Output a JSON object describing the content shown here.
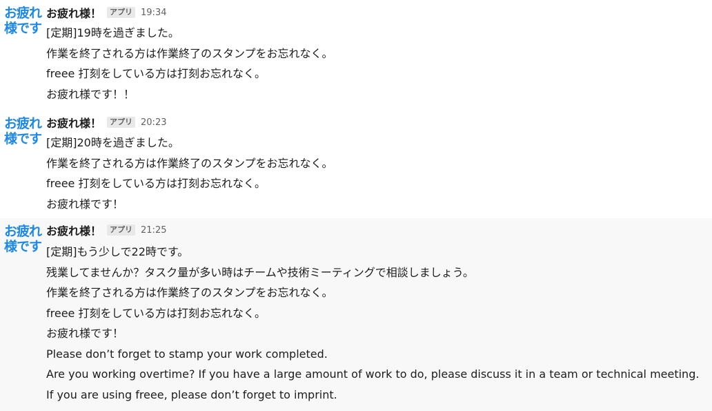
{
  "messages": [
    {
      "avatar": [
        "お疲れ",
        "様です"
      ],
      "sender": "お疲れ様！",
      "badge": "アプリ",
      "time": "19:34",
      "lines": [
        "[定期]19時を過ぎました。",
        "作業を終了される方は作業終了のスタンプをお忘れなく。",
        "freee 打刻をしている方は打刻お忘れなく。",
        "お疲れ様です！！"
      ]
    },
    {
      "avatar": [
        "お疲れ",
        "様です"
      ],
      "sender": "お疲れ様！",
      "badge": "アプリ",
      "time": "20:23",
      "lines": [
        "[定期]20時を過ぎました。",
        "作業を終了される方は作業終了のスタンプをお忘れなく。",
        "freee 打刻をしている方は打刻お忘れなく。",
        "お疲れ様です！"
      ]
    },
    {
      "avatar": [
        "お疲れ",
        "様です"
      ],
      "sender": "お疲れ様！",
      "badge": "アプリ",
      "time": "21:25",
      "lines": [
        "[定期]もう少しで22時です。",
        "残業してませんか？タスク量が多い時はチームや技術ミーティングで相談しましょう。",
        "作業を終了される方は作業終了のスタンプをお忘れなく。",
        "freee 打刻をしている方は打刻お忘れなく。",
        "お疲れ様です！",
        "Please don’t forget to stamp your work completed.",
        "Are you working overtime? If you have a large amount of work to do, please discuss it in a team or technical meeting.",
        "If you are using freee, please don’t forget to imprint."
      ]
    }
  ]
}
